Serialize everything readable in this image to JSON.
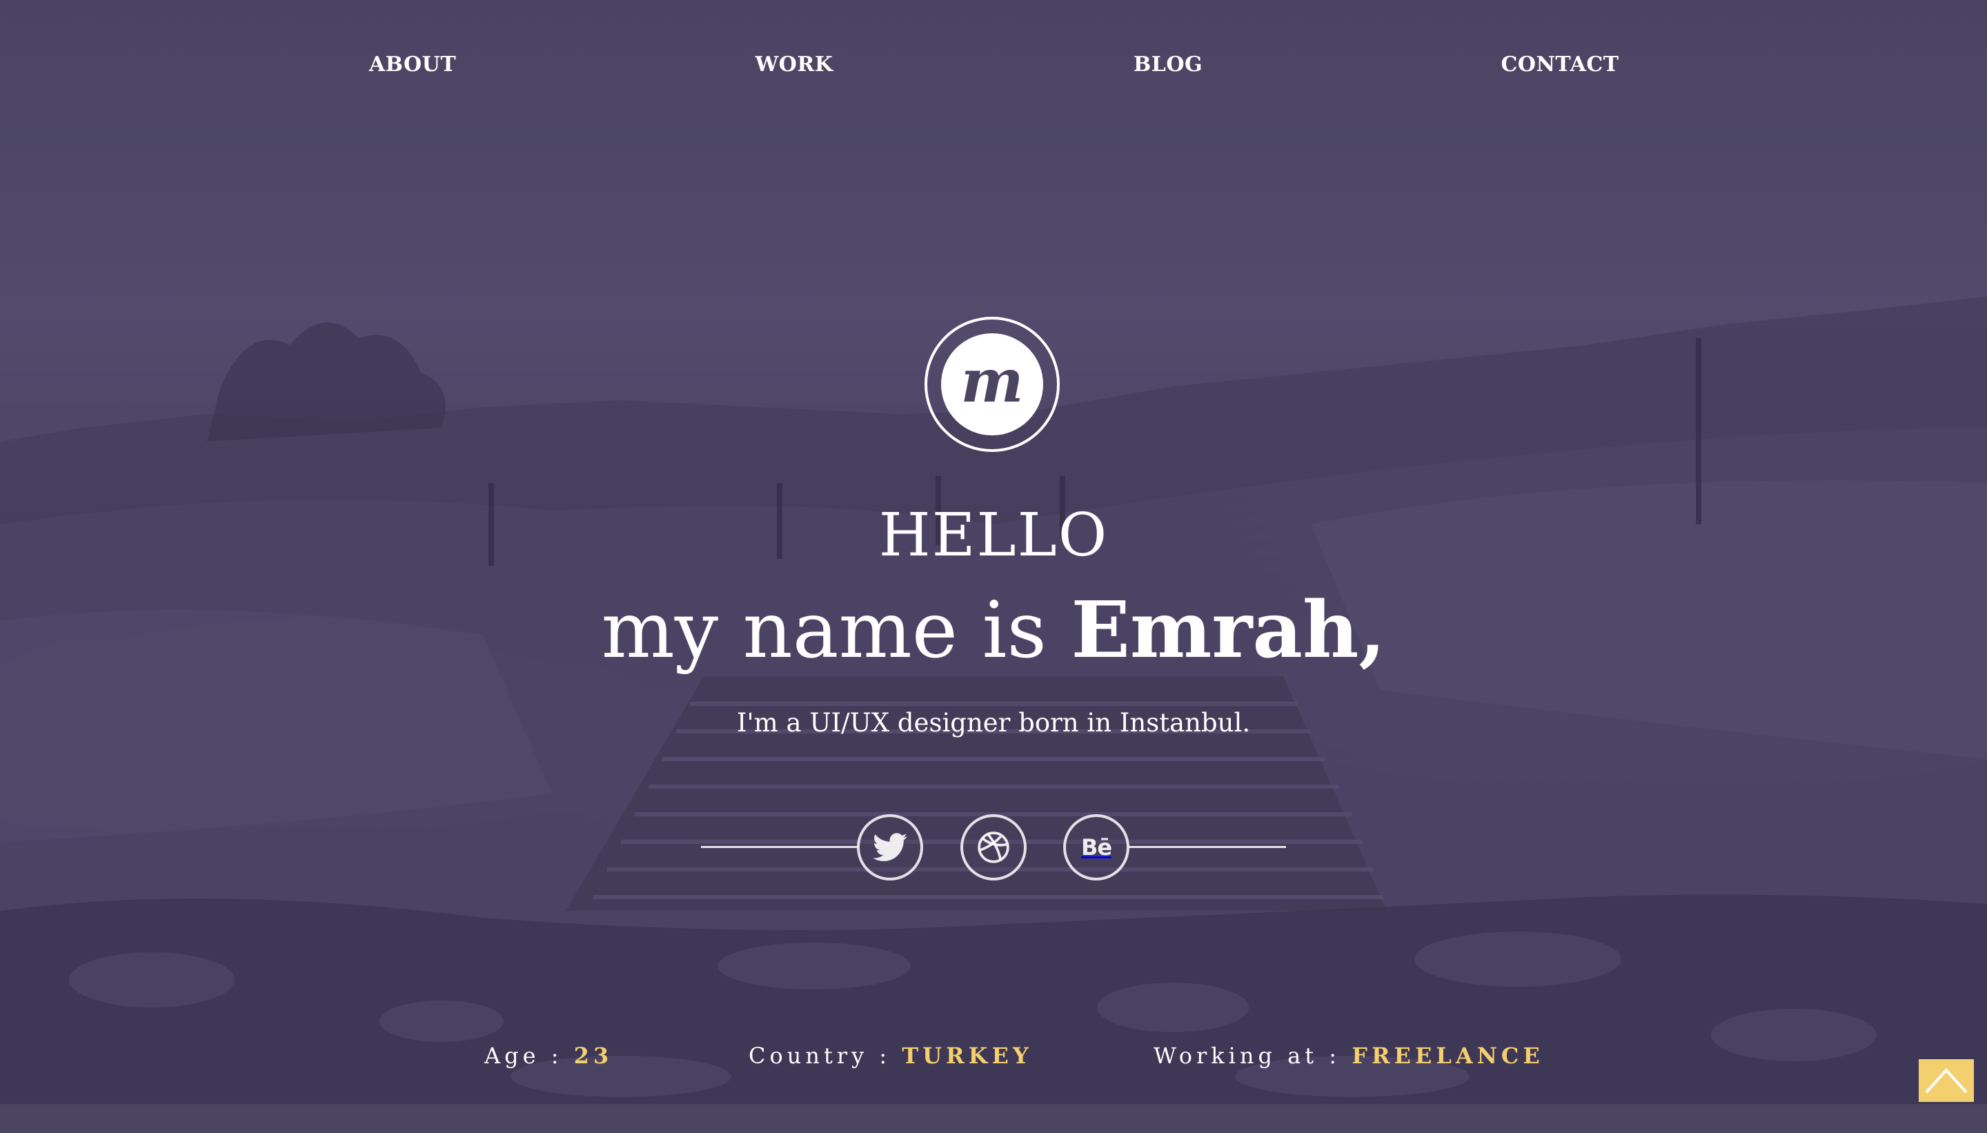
{
  "nav": {
    "about": "ABOUT",
    "work": "WORK",
    "blog": "BLOG",
    "contact": "CONTACT"
  },
  "logo": {
    "letter": "m",
    "icon": "logo-monogram-icon"
  },
  "hero": {
    "hello": "HELLO",
    "name_prefix": "my name is ",
    "name": "Emrah,",
    "tagline": "I'm a UI/UX designer born in Instanbul."
  },
  "social": [
    {
      "name": "Twitter",
      "icon": "twitter-bird-icon"
    },
    {
      "name": "Dribbble",
      "icon": "dribbble-ball-icon"
    },
    {
      "name": "Behance",
      "icon": "behance-icon",
      "glyph": "Bē"
    }
  ],
  "info": {
    "age_label": "Age : ",
    "age_value": "23",
    "country_label": "Country : ",
    "country_value": "TURKEY",
    "work_label": "Working at : ",
    "work_value": "FREELANCE"
  },
  "back_to_top": {
    "icon": "chevron-up-icon"
  },
  "colors": {
    "overlay": "#4b4562",
    "accent": "#f3cf6e",
    "text": "#ffffff"
  }
}
